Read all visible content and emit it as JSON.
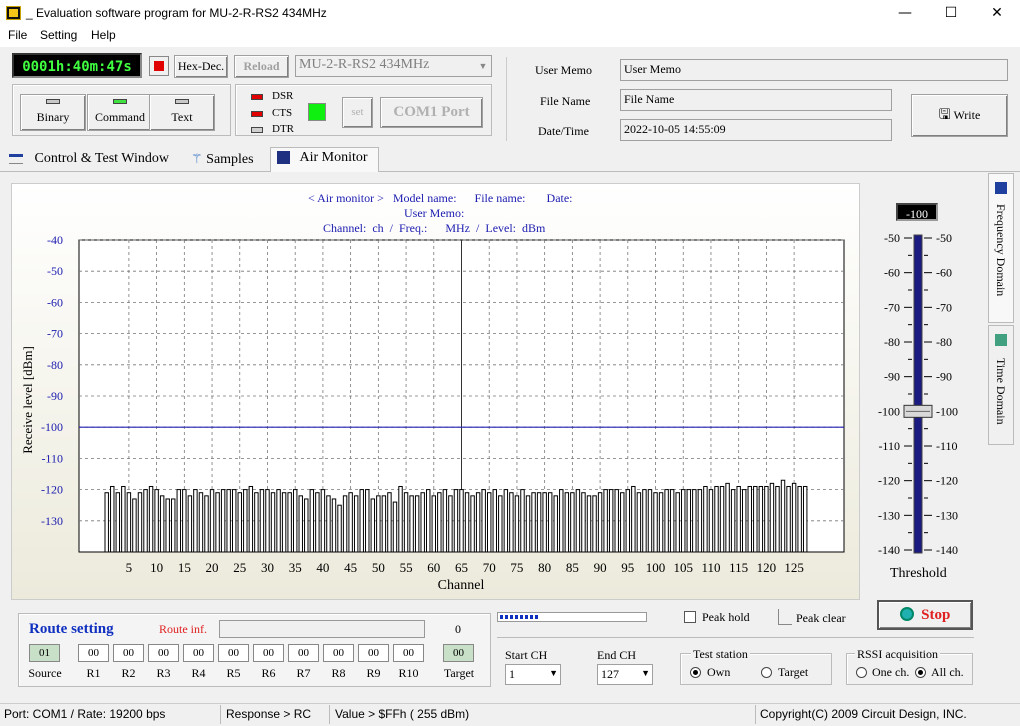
{
  "window": {
    "title": "Evaluation software program for MU-2-R-RS2  434MHz",
    "minimize": "—",
    "maximize": "☐",
    "close": "✕"
  },
  "menu": [
    "File",
    "Setting",
    "Help"
  ],
  "toolbar": {
    "timer": "0001h:40m:47s",
    "hexdec": "Hex-Dec.",
    "reload": "Reload",
    "model": "MU-2-R-RS2  434MHz",
    "modes": [
      "Binary",
      "Command",
      "Text"
    ],
    "signals": [
      "DSR",
      "CTS",
      "DTR"
    ],
    "set": "set",
    "port": "COM1 Port"
  },
  "info": {
    "memo_label": "User Memo",
    "memo_value": "User Memo",
    "file_label": "File Name",
    "file_value": "File Name",
    "date_label": "Date/Time",
    "date_value": "2022-10-05 14:55:09",
    "write": "Write"
  },
  "tabs": [
    "Control  & Test Window",
    "Samples",
    "Air Monitor"
  ],
  "side_tabs": [
    "Frequency Domain",
    "Time Domain"
  ],
  "header": {
    "line1_a": "< Air monitor >",
    "line1_b": "Model name:",
    "line1_c": "File name:",
    "line1_d": "Date:",
    "line2": "User Memo:",
    "line3_a": "Channel:",
    "line3_b": "ch",
    "line3_c": "/",
    "line3_d": "Freq.:",
    "line3_e": "MHz",
    "line3_f": "/",
    "line3_g": "Level:",
    "line3_h": "dBm"
  },
  "chart_data": {
    "type": "bar",
    "ylabel": "Receive level [dBm]",
    "xlabel": "Channel",
    "ylim": [
      -140,
      -40
    ],
    "yticks": [
      -40,
      -50,
      -60,
      -70,
      -80,
      -90,
      -100,
      -110,
      -120,
      -130
    ],
    "xlim": [
      -4,
      134
    ],
    "xticks": [
      5,
      10,
      15,
      20,
      25,
      30,
      35,
      40,
      45,
      50,
      55,
      60,
      65,
      70,
      75,
      80,
      85,
      90,
      95,
      100,
      105,
      110,
      115,
      120,
      125
    ],
    "threshold_line": -100,
    "x": [
      1,
      127
    ],
    "values": [
      -121,
      -119,
      -121,
      -119,
      -121,
      -123,
      -121,
      -120,
      -119,
      -120,
      -122,
      -123,
      -123,
      -120,
      -120,
      -122,
      -120,
      -121,
      -122,
      -120,
      -121,
      -120,
      -120,
      -120,
      -121,
      -120,
      -119,
      -121,
      -120,
      -120,
      -121,
      -120,
      -121,
      -121,
      -120,
      -122,
      -123,
      -120,
      -121,
      -120,
      -122,
      -123,
      -125,
      -122,
      -121,
      -122,
      -120,
      -120,
      -123,
      -122,
      -122,
      -121,
      -124,
      -119,
      -121,
      -122,
      -122,
      -121,
      -120,
      -122,
      -121,
      -120,
      -122,
      -120,
      -120,
      -121,
      -122,
      -121,
      -120,
      -121,
      -120,
      -122,
      -120,
      -121,
      -122,
      -120,
      -122,
      -121,
      -121,
      -121,
      -121,
      -122,
      -120,
      -121,
      -121,
      -120,
      -121,
      -122,
      -122,
      -121,
      -120,
      -120,
      -120,
      -121,
      -120,
      -119,
      -121,
      -120,
      -120,
      -121,
      -121,
      -120,
      -120,
      -121,
      -120,
      -120,
      -120,
      -120,
      -119,
      -120,
      -119,
      -119,
      -118,
      -120,
      -119,
      -120,
      -119,
      -119,
      -119,
      -119,
      -118,
      -119,
      -117,
      -119,
      -118,
      -119,
      -119
    ]
  },
  "threshold": {
    "value": "-100",
    "ticks": [
      "-50",
      "-60",
      "-70",
      "-80",
      "-90",
      "-100",
      "-110",
      "-120",
      "-130",
      "-140"
    ],
    "label": "Threshold",
    "level": -100,
    "range": [
      -140,
      -50
    ]
  },
  "route": {
    "title": "Route setting",
    "info_label": "Route inf.",
    "count": "0",
    "source_value": "01",
    "target_value": "00",
    "cells": [
      "00",
      "00",
      "00",
      "00",
      "00",
      "00",
      "00",
      "00",
      "00",
      "00"
    ],
    "labels": [
      "Source",
      "R1",
      "R2",
      "R3",
      "R4",
      "R5",
      "R6",
      "R7",
      "R8",
      "R9",
      "R10",
      "Target"
    ]
  },
  "controls": {
    "peak_hold": "Peak hold",
    "peak_clear": "Peak clear",
    "stop": "Stop",
    "start_label": "Start CH",
    "start_value": "1",
    "end_label": "End CH",
    "end_value": "127",
    "test_station": "Test station",
    "own": "Own",
    "target": "Target",
    "rssi": "RSSI acquisition",
    "one_ch": "One ch.",
    "all_ch": "All ch."
  },
  "status": {
    "port": "Port: COM1 / Rate: 19200 bps",
    "response": "Response > RC",
    "value": "Value > $FFh ( 255 dBm)",
    "copyright": "Copyright(C) 2009 Circuit Design, INC."
  }
}
